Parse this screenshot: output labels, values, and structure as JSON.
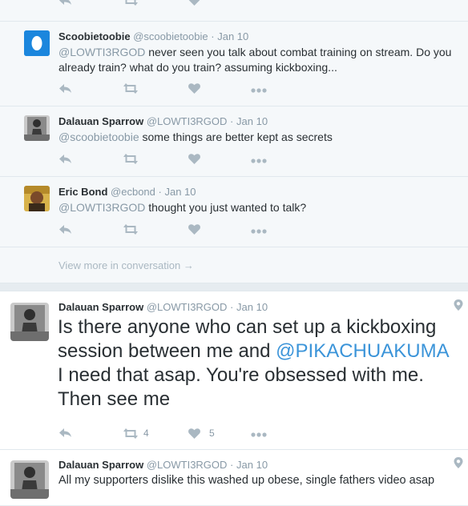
{
  "conversation": {
    "tweets": [
      {
        "name": "Scoobietoobie",
        "handle": "@scoobietoobie",
        "date": "Jan 10",
        "mention": "@LOWTI3RGOD",
        "text": " never seen you talk about combat training on stream. Do you already train? what do you train? assuming kickboxing..."
      },
      {
        "name": "Dalauan Sparrow",
        "handle": "@LOWTI3RGOD",
        "date": "Jan 10",
        "mention": "@scoobietoobie",
        "text": " some things are better kept as secrets"
      },
      {
        "name": "Eric Bond",
        "handle": "@ecbond",
        "date": "Jan 10",
        "mention": "@LOWTI3RGOD",
        "text": " thought you just wanted to talk?"
      }
    ],
    "view_more": "View more in conversation →"
  },
  "main_tweet": {
    "name": "Dalauan Sparrow",
    "handle": "@LOWTI3RGOD",
    "date": "Jan 10",
    "text_before": "Is there anyone who can set up a kickboxing session between me and ",
    "mention": "@PIKACHUAKUMA",
    "text_after": " I need that asap. You're obsessed with me. Then see me",
    "retweets": "4",
    "likes": "5"
  },
  "next_tweet": {
    "name": "Dalauan Sparrow",
    "handle": "@LOWTI3RGOD",
    "date": "Jan 10",
    "text": "All my supporters dislike this washed up obese, single fathers video asap"
  },
  "separator": "·",
  "icons": [
    "reply-icon",
    "retweet-icon",
    "like-icon",
    "more-icon",
    "location-pin-icon"
  ],
  "colors": {
    "accent": "#3b94d9",
    "muted": "#8899a6",
    "icon": "#aab8c2",
    "background": "#e6ecf0"
  }
}
